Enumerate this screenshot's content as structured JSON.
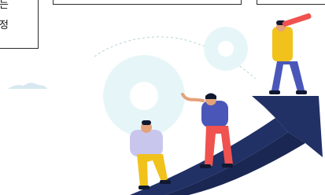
{
  "text_box": {
    "line1": "는",
    "line2": "정"
  },
  "colors": {
    "arrow": "#213065",
    "arrow_accent": "#2d3f7a",
    "gear": "#e6f6f8",
    "cloud": "#d8e8f0",
    "yellow": "#f1c21b",
    "blue_shirt": "#4a57b8",
    "coral_pants": "#f0524f",
    "skin": "#e4a27b",
    "dark": "#111831",
    "lavender_shirt": "#c9c6ee"
  },
  "icons": [
    "gear-icon",
    "cloud-icon",
    "growth-arrow-icon",
    "person-telescope-icon",
    "person-pointing-icon",
    "person-climbing-icon"
  ]
}
